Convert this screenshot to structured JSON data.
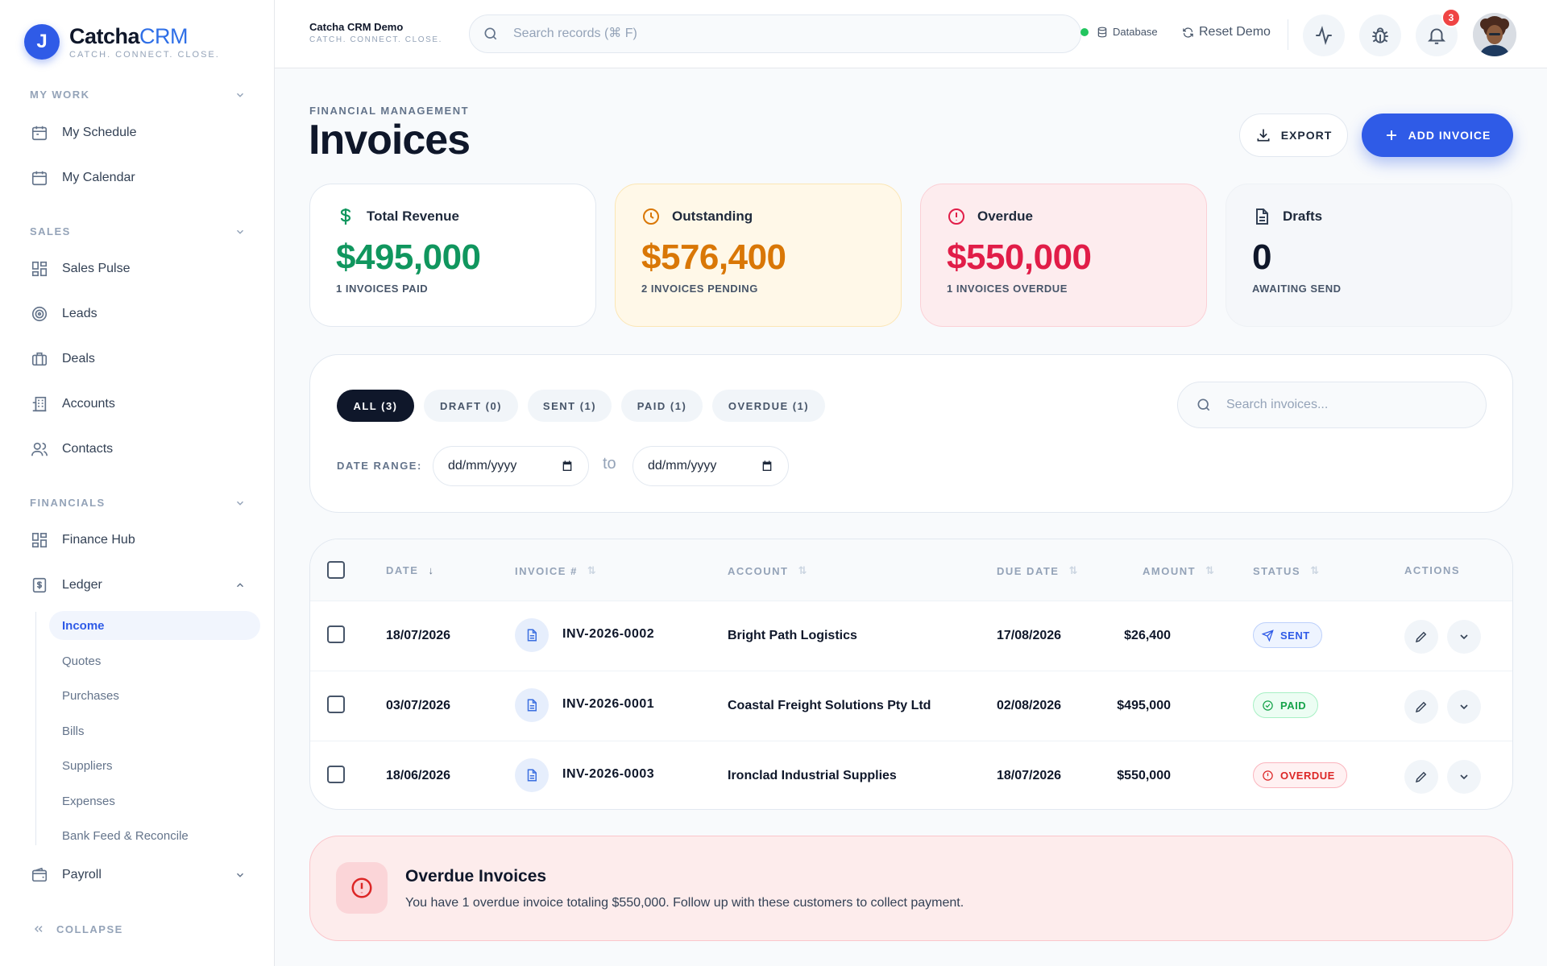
{
  "brand": {
    "logo_letter": "J",
    "name_main": "Catcha",
    "name_accent": "CRM",
    "tagline": "CATCH. CONNECT. CLOSE."
  },
  "sidebar": {
    "sections": [
      {
        "label": "MY WORK",
        "items": [
          {
            "label": "My Schedule",
            "icon": "calendar-icon"
          },
          {
            "label": "My Calendar",
            "icon": "calendar-icon"
          }
        ]
      },
      {
        "label": "SALES",
        "items": [
          {
            "label": "Sales Pulse",
            "icon": "grid-icon"
          },
          {
            "label": "Leads",
            "icon": "target-icon"
          },
          {
            "label": "Deals",
            "icon": "briefcase-icon"
          },
          {
            "label": "Accounts",
            "icon": "building-icon"
          },
          {
            "label": "Contacts",
            "icon": "users-icon"
          }
        ]
      },
      {
        "label": "FINANCIALS",
        "items": [
          {
            "label": "Finance Hub",
            "icon": "grid-icon"
          },
          {
            "label": "Ledger",
            "icon": "dollar-doc-icon"
          }
        ]
      }
    ],
    "ledger_sub": [
      "Income",
      "Quotes",
      "Purchases",
      "Bills",
      "Suppliers",
      "Expenses",
      "Bank Feed & Reconcile"
    ],
    "active_sub": "Income",
    "payroll": "Payroll",
    "collapse": "COLLAPSE"
  },
  "topbar": {
    "app_name": "Catcha CRM Demo",
    "app_tagline": "CATCH. CONNECT. CLOSE.",
    "search_placeholder": "Search records (⌘ F)",
    "database": "Database",
    "reset": "Reset Demo",
    "notifications_count": "3",
    "status_color": "#22c55e"
  },
  "page": {
    "eyebrow": "FINANCIAL MANAGEMENT",
    "title": "Invoices",
    "export_label": "EXPORT",
    "add_label": "ADD INVOICE"
  },
  "cards": [
    {
      "label": "Total Revenue",
      "value": "$495,000",
      "sub": "1 INVOICES PAID",
      "color": "#10965e",
      "icon": "dollar-icon"
    },
    {
      "label": "Outstanding",
      "value": "$576,400",
      "sub": "2 INVOICES PENDING",
      "color": "#d97706",
      "icon": "clock-icon"
    },
    {
      "label": "Overdue",
      "value": "$550,000",
      "sub": "1 INVOICES OVERDUE",
      "color": "#e11d48",
      "icon": "alert-circle-icon"
    },
    {
      "label": "Drafts",
      "value": "0",
      "sub": "AWAITING SEND",
      "color": "#0f172a",
      "icon": "document-icon"
    }
  ],
  "filters": {
    "tabs": [
      "ALL (3)",
      "DRAFT (0)",
      "SENT (1)",
      "PAID (1)",
      "OVERDUE (1)"
    ],
    "active_tab": "ALL (3)",
    "search_placeholder": "Search invoices...",
    "date_range_label": "DATE RANGE:",
    "date_from": "dd/mm/yyyy",
    "date_to": "dd/mm/yyyy",
    "to_label": "to"
  },
  "table": {
    "columns": [
      "DATE",
      "INVOICE #",
      "ACCOUNT",
      "DUE DATE",
      "AMOUNT",
      "STATUS",
      "ACTIONS"
    ],
    "rows": [
      {
        "date": "18/07/2026",
        "invoice": "INV-2026-0002",
        "account": "Bright Path Logistics",
        "due": "17/08/2026",
        "amount": "$26,400",
        "status": "SENT"
      },
      {
        "date": "03/07/2026",
        "invoice": "INV-2026-0001",
        "account": "Coastal Freight Solutions Pty Ltd",
        "due": "02/08/2026",
        "amount": "$495,000",
        "status": "PAID"
      },
      {
        "date": "18/06/2026",
        "invoice": "INV-2026-0003",
        "account": "Ironclad Industrial Supplies",
        "due": "18/07/2026",
        "amount": "$550,000",
        "status": "OVERDUE"
      }
    ]
  },
  "alert": {
    "title": "Overdue Invoices",
    "text": "You have 1 overdue invoice totaling $550,000. Follow up with these customers to collect payment."
  }
}
